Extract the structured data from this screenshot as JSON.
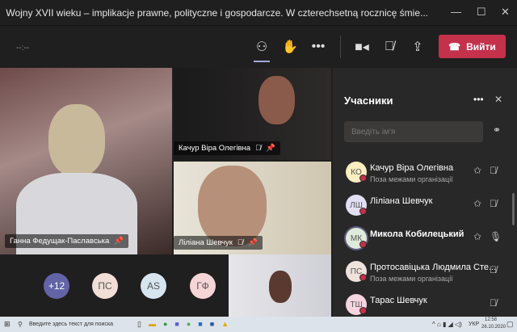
{
  "window": {
    "title": "Wojny XVII wieku – implikacje prawne, polityczne i gospodarcze. W czterechsetną rocznicę śmie...",
    "minimize": "—",
    "maximize": "☐",
    "close": "✕"
  },
  "toolbar": {
    "timer": "--:--",
    "leave_label": "Вийти"
  },
  "videos": [
    {
      "name": "Ганна Федущак-Паславська"
    },
    {
      "name": "Качур Віра Олегівна"
    },
    {
      "name": "Ліліана Шевчук"
    }
  ],
  "bubbles": [
    {
      "label": "+12",
      "color": "#6264a7"
    },
    {
      "label": "ПС",
      "color": "#f1ded7"
    },
    {
      "label": "AS",
      "color": "#d6e5ef"
    },
    {
      "label": "ГФ",
      "color": "#f6d5d6"
    }
  ],
  "panel": {
    "title": "Учасники",
    "search_placeholder": "Введіть ім'я",
    "participants": [
      {
        "initials": "КО",
        "name": "Качур Віра Олегівна",
        "sub": "Поза межами організації",
        "color": "#fbeec0",
        "pin": true,
        "mic": "muted"
      },
      {
        "initials": "ЛШ",
        "name": "Ліліана Шевчук",
        "sub": "",
        "color": "#e3dff3",
        "pin": true,
        "mic": "muted"
      },
      {
        "initials": "МК",
        "name": "Микола Кобилецький",
        "sub": "",
        "color": "#dfeadb",
        "pin": true,
        "mic": "on"
      },
      {
        "initials": "ПС",
        "name": "Протосавіцька Людмила Сте...",
        "sub": "Поза межами організації",
        "color": "#efe2dc",
        "pin": false,
        "mic": "muted"
      },
      {
        "initials": "ТШ",
        "name": "Тарас Шевчук",
        "sub": "",
        "color": "#f6d5e0",
        "pin": false,
        "mic": "muted"
      }
    ]
  },
  "taskbar": {
    "search_placeholder": "Введите здесь текст для поиска",
    "lang": "УКР",
    "time": "12:58",
    "date": "26.10.2020"
  }
}
